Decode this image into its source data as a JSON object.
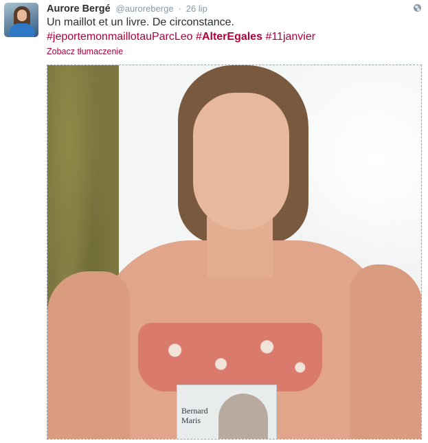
{
  "tweet": {
    "name": "Aurore Bergé",
    "handle": "@auroreberge",
    "separator": "·",
    "time": "26 lip",
    "text_line1": "Un maillot et un livre. De circonstance.",
    "hashtags": [
      {
        "hash": "#",
        "tag": "jeportemonmaillotauParcLeo",
        "bold": false
      },
      {
        "hash": "#",
        "tag": "AlterEgales",
        "bold": true
      },
      {
        "hash": "#",
        "tag": "11janvier",
        "bold": false
      }
    ],
    "translate_label": "Zobacz tłumaczenie",
    "book_cover_text": [
      "Bernard",
      "Maris"
    ]
  },
  "icons": {
    "avatar": "user-avatar",
    "globe": "globe-icon"
  },
  "colors": {
    "hashtag": "#b0003a",
    "muted": "#8899a6",
    "text": "#292f33"
  }
}
